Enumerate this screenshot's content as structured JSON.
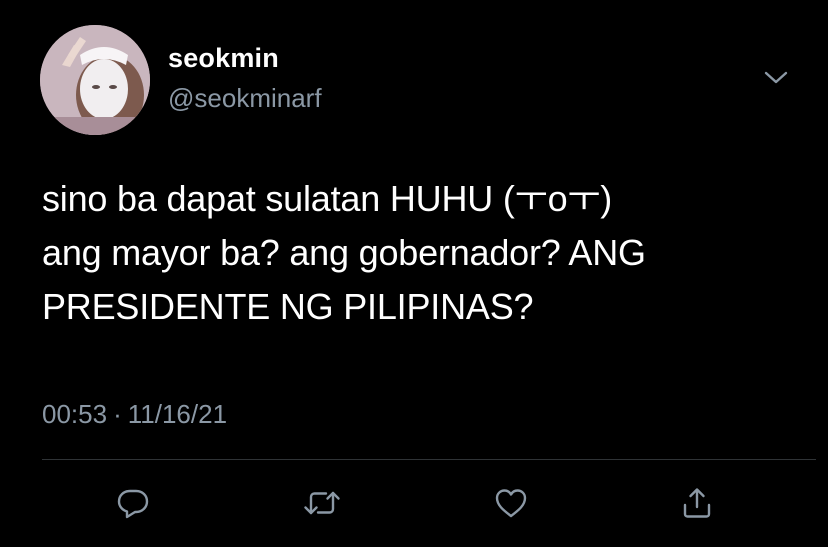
{
  "tweet": {
    "author": {
      "display_name": "seokmin",
      "handle": "@seokminarf",
      "avatar_icon": "avatar-photo"
    },
    "text": "sino ba dapat sulatan HUHU (ㅜoㅜ)\nang mayor ba? ang gobernador? ANG\nPRESIDENTE NG PILIPINAS?",
    "time": "00:53",
    "separator": "·",
    "date": "11/16/21",
    "more_icon": "chevron-down-icon",
    "actions": [
      {
        "name": "reply",
        "icon": "reply-icon"
      },
      {
        "name": "retweet",
        "icon": "retweet-icon"
      },
      {
        "name": "like",
        "icon": "heart-icon"
      },
      {
        "name": "share",
        "icon": "share-icon"
      }
    ]
  },
  "colors": {
    "background": "#000000",
    "primary_text": "#ffffff",
    "secondary_text": "#8b98a5",
    "divider": "#2f3336",
    "icon": "#8b98a5"
  }
}
